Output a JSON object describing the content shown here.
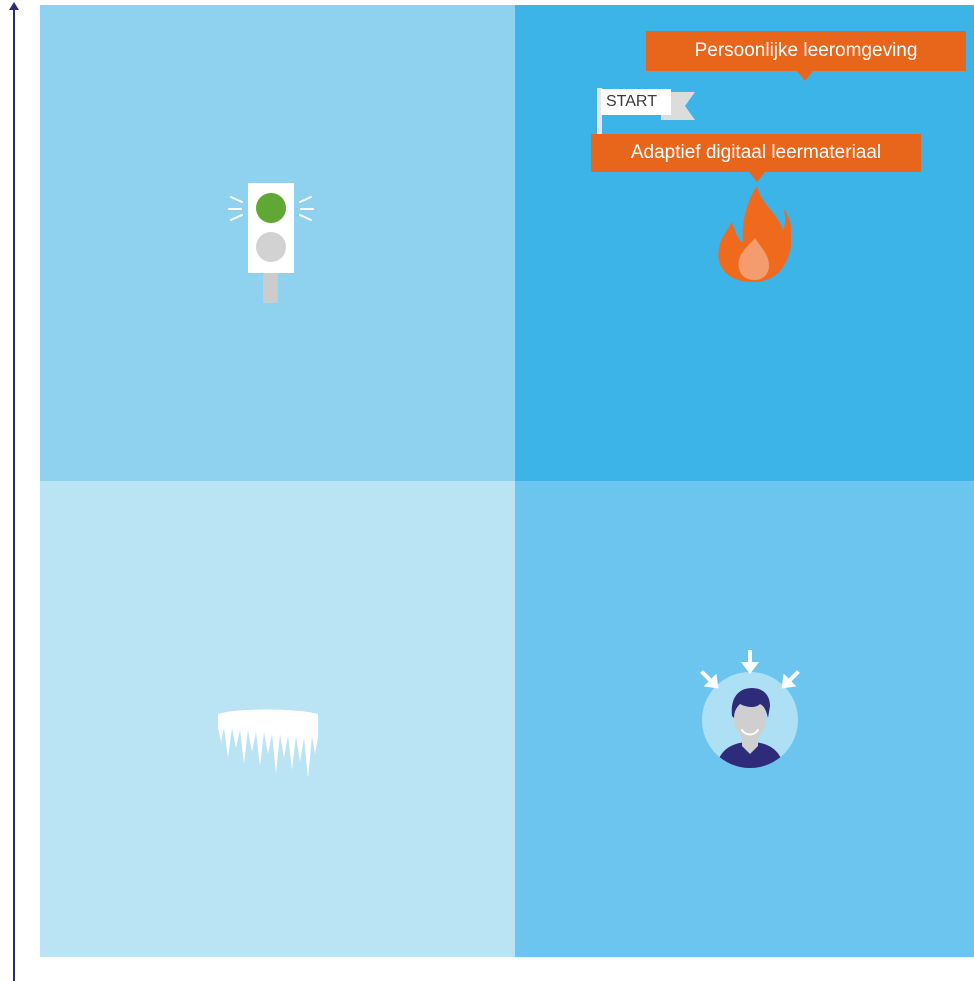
{
  "colors": {
    "axis": "#2e2b7a",
    "quadrant_top_left": "#8fd2f0",
    "quadrant_top_right": "#3db4e8",
    "quadrant_bottom_left": "#bae3f4",
    "quadrant_bottom_right": "#6cc5ee",
    "callout": "#e8661c",
    "traffic_light_green": "#5fa833",
    "traffic_light_grey": "#d2d2d2",
    "flame_outer": "#f06a1e",
    "flame_inner": "#f59c6e",
    "person_dark": "#2e2b7a"
  },
  "labels": {
    "personal_learning_environment": "Persoonlijke leeromgeving",
    "adaptive_material": "Adaptief digitaal leermateriaal",
    "start_flag": "START"
  },
  "icons": {
    "top_left": "traffic-light-icon",
    "top_right": "fire-icon",
    "bottom_left": "icicles-icon",
    "bottom_right": "person-focus-icon"
  }
}
